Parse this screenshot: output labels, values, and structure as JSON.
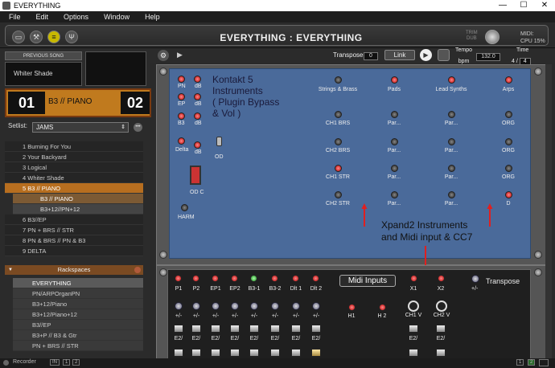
{
  "window": {
    "title": "EVERYTHING",
    "min": "—",
    "max": "☐",
    "close": "✕"
  },
  "menu": [
    "File",
    "Edit",
    "Options",
    "Window",
    "Help"
  ],
  "toolbar": {
    "main_title": "EVERYTHING : EVERYTHING",
    "trim": "TRIM",
    "dub": "DUB",
    "midi": "MIDI:",
    "cpu": "CPU 15%"
  },
  "left": {
    "previous_song": "PREVIOUS SONG",
    "previous_name": "Whiter Shade",
    "current_num": "01",
    "current_name": "B3 // PIANO",
    "next_num": "02",
    "setlist_label": "Setlist:",
    "setlist_value": "JAMS",
    "songs": [
      {
        "label": "1 Burning For You"
      },
      {
        "label": "2 Your Backyard"
      },
      {
        "label": "3 Logical"
      },
      {
        "label": "4 Whiter Shade"
      },
      {
        "label": "5 B3 // PIANO"
      },
      {
        "label": "B3 // PIANO"
      },
      {
        "label": "B3+12//PN+12"
      },
      {
        "label": "6 B3//EP"
      },
      {
        "label": "7 PN + BRS // STR"
      },
      {
        "label": "8 PN & BRS // PN & B3"
      },
      {
        "label": "9 DELTA"
      }
    ],
    "rackspaces_label": "Rackspaces",
    "racks": [
      "EVERYTHING",
      "PN/ARPOrganPN",
      "B3+12/Piano",
      "B3+12/Piano+12",
      "B3//EP",
      "B3+P // B3 & Gtr",
      "PN + BRS // STR"
    ]
  },
  "status": {
    "recorder": "Recorder",
    "in": "IN",
    "b1": "1",
    "b2": "2",
    "p1": "1",
    "p2": "2"
  },
  "rack_toolbar": {
    "transpose_label": "Transpose",
    "transpose_value": "0",
    "link": "Link",
    "tempo": "Tempo",
    "bpm": "bpm",
    "bpm_value": "132.0",
    "time": "Time",
    "time_num": "4",
    "time_den": "4"
  },
  "panel1": {
    "left_leds": [
      "PN",
      "EP",
      "B3",
      "Delta"
    ],
    "db": "dB",
    "od": "OD",
    "odc": "OD C",
    "harm": "HARM",
    "note": [
      "Kontakt 5",
      "Instruments",
      "( Plugin Bypass",
      "& Vol )"
    ],
    "header_leds": [
      "Strings & Brass",
      "Pads",
      "Lead Synths",
      "Arps"
    ],
    "rows": [
      [
        "CH1 BRS",
        "Par...",
        "Par...",
        "ORG"
      ],
      [
        "CH2 BRS",
        "Par...",
        "Par...",
        "ORG"
      ],
      [
        "CH1 STR",
        "Par...",
        "Par...",
        "ORG"
      ],
      [
        "CH2 STR",
        "Par...",
        "Par...",
        "D"
      ]
    ],
    "note2": [
      "Xpand2 Instruments",
      "and Midi input & CC7"
    ]
  },
  "panel2": {
    "leds": [
      "P1",
      "P2",
      "EP1",
      "EP2",
      "B3-1",
      "B3-2",
      "Dlt 1",
      "Dlt 2"
    ],
    "midi_inputs": "Midi Inputs",
    "x_leds": [
      "X1",
      "X2"
    ],
    "transpose": "Transpose",
    "pm": "+/-",
    "h": [
      "H1",
      "H 2"
    ],
    "ch": [
      "CH1 V",
      "CH2 V"
    ],
    "e2": "E2/"
  }
}
